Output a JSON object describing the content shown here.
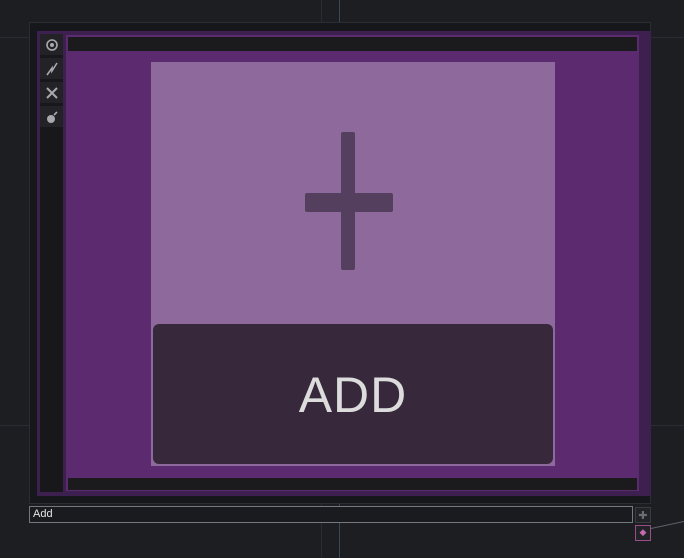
{
  "node": {
    "toolbar": {
      "icons": [
        "target-icon",
        "bypass-icon",
        "close-icon",
        "bomb-icon"
      ]
    },
    "card": {
      "icon": "plus-icon",
      "button_label": "ADD"
    },
    "name_field": {
      "value": "Add"
    },
    "side_buttons": [
      "add-small-icon",
      "pin-icon"
    ]
  },
  "colors": {
    "node_background": "#5c2a6f",
    "card": "#8e6a9c",
    "button": "#37293b",
    "accent_pin": "#c46ab1"
  }
}
